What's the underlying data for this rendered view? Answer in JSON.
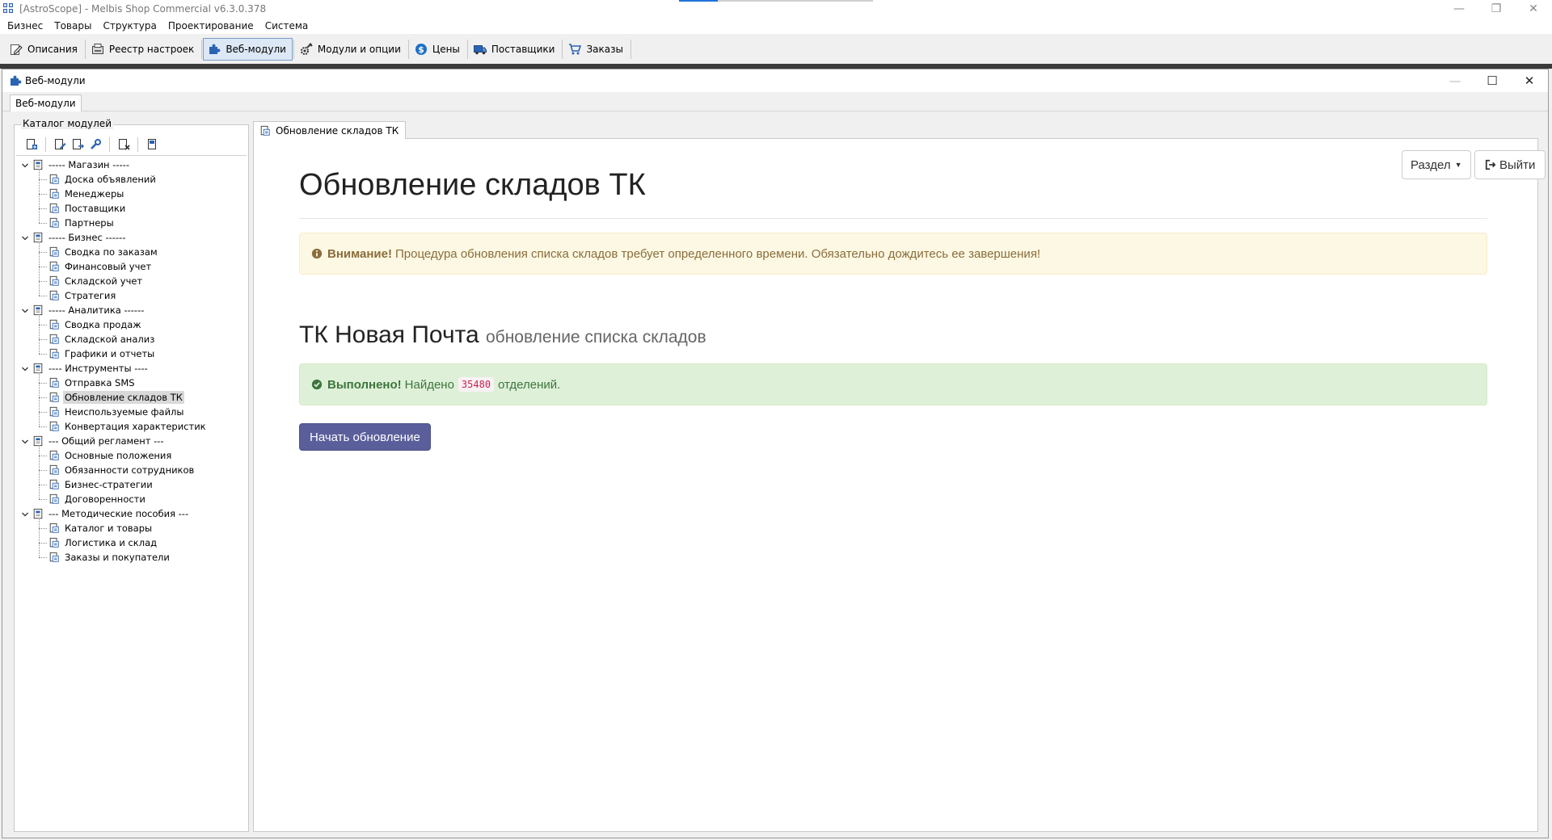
{
  "window": {
    "title": "[AstroScope] - Melbis Shop Commercial v6.3.0.378",
    "controls": {
      "minimize": "—",
      "restore": "❐",
      "close": "✕"
    }
  },
  "menu": [
    "Бизнес",
    "Товары",
    "Структура",
    "Проектирование",
    "Система"
  ],
  "toolbar": [
    {
      "label": "Описания",
      "icon": "edit-icon",
      "active": false
    },
    {
      "label": "Реестр настроек",
      "icon": "registry-icon",
      "active": false
    },
    {
      "label": "Веб-модули",
      "icon": "puzzle-icon",
      "active": true
    },
    {
      "label": "Модули и опции",
      "icon": "gear-wrench-icon",
      "active": false
    },
    {
      "label": "Цены",
      "icon": "dollar-icon",
      "active": false
    },
    {
      "label": "Поставщики",
      "icon": "truck-icon",
      "active": false
    },
    {
      "label": "Заказы",
      "icon": "cart-icon",
      "active": false
    }
  ],
  "inner_window": {
    "title": "Веб-модули",
    "tab": "Веб-модули",
    "controls": {
      "minimize": "—",
      "maximize": "☐",
      "close": "✕"
    }
  },
  "catalog": {
    "label": "Каталог модулей",
    "groups": [
      {
        "label": "----- Магазин -----",
        "items": [
          "Доска объявлений",
          "Менеджеры",
          "Поставщики",
          "Партнеры"
        ]
      },
      {
        "label": "----- Бизнес ------",
        "items": [
          "Сводка по заказам",
          "Финансовый учет",
          "Складской учет",
          "Стратегия"
        ]
      },
      {
        "label": "----- Аналитика ------",
        "items": [
          "Сводка продаж",
          "Складской анализ",
          "Графики и отчеты"
        ]
      },
      {
        "label": "---- Инструменты ----",
        "items": [
          "Отправка SMS",
          "Обновление складов ТК",
          "Неиспользуемые файлы",
          "Конвертация характеристик"
        ]
      },
      {
        "label": "--- Общий регламент ---",
        "items": [
          "Основные положения",
          "Обязанности сотрудников",
          "Бизнес-стратегии",
          "Договоренности"
        ]
      },
      {
        "label": "--- Методические пособия ---",
        "items": [
          "Каталог и товары",
          "Логистика и склад",
          "Заказы и покупатели"
        ]
      }
    ],
    "selected": "Обновление складов ТК"
  },
  "content": {
    "tab": "Обновление складов ТК",
    "section_button": "Раздел",
    "exit_button": "Выйти",
    "heading": "Обновление складов ТК",
    "warning_bold": "Внимание!",
    "warning_text": "Процедура обновления списка складов требует определенного времени. Обязательно дождитесь ее завершения!",
    "sub_heading": "ТК Новая Почта",
    "sub_heading_small": "обновление списка складов",
    "success_bold": "Выполнено!",
    "success_prefix": "Найдено",
    "success_count": "35480",
    "success_suffix": "отделений.",
    "start_button": "Начать обновление"
  }
}
